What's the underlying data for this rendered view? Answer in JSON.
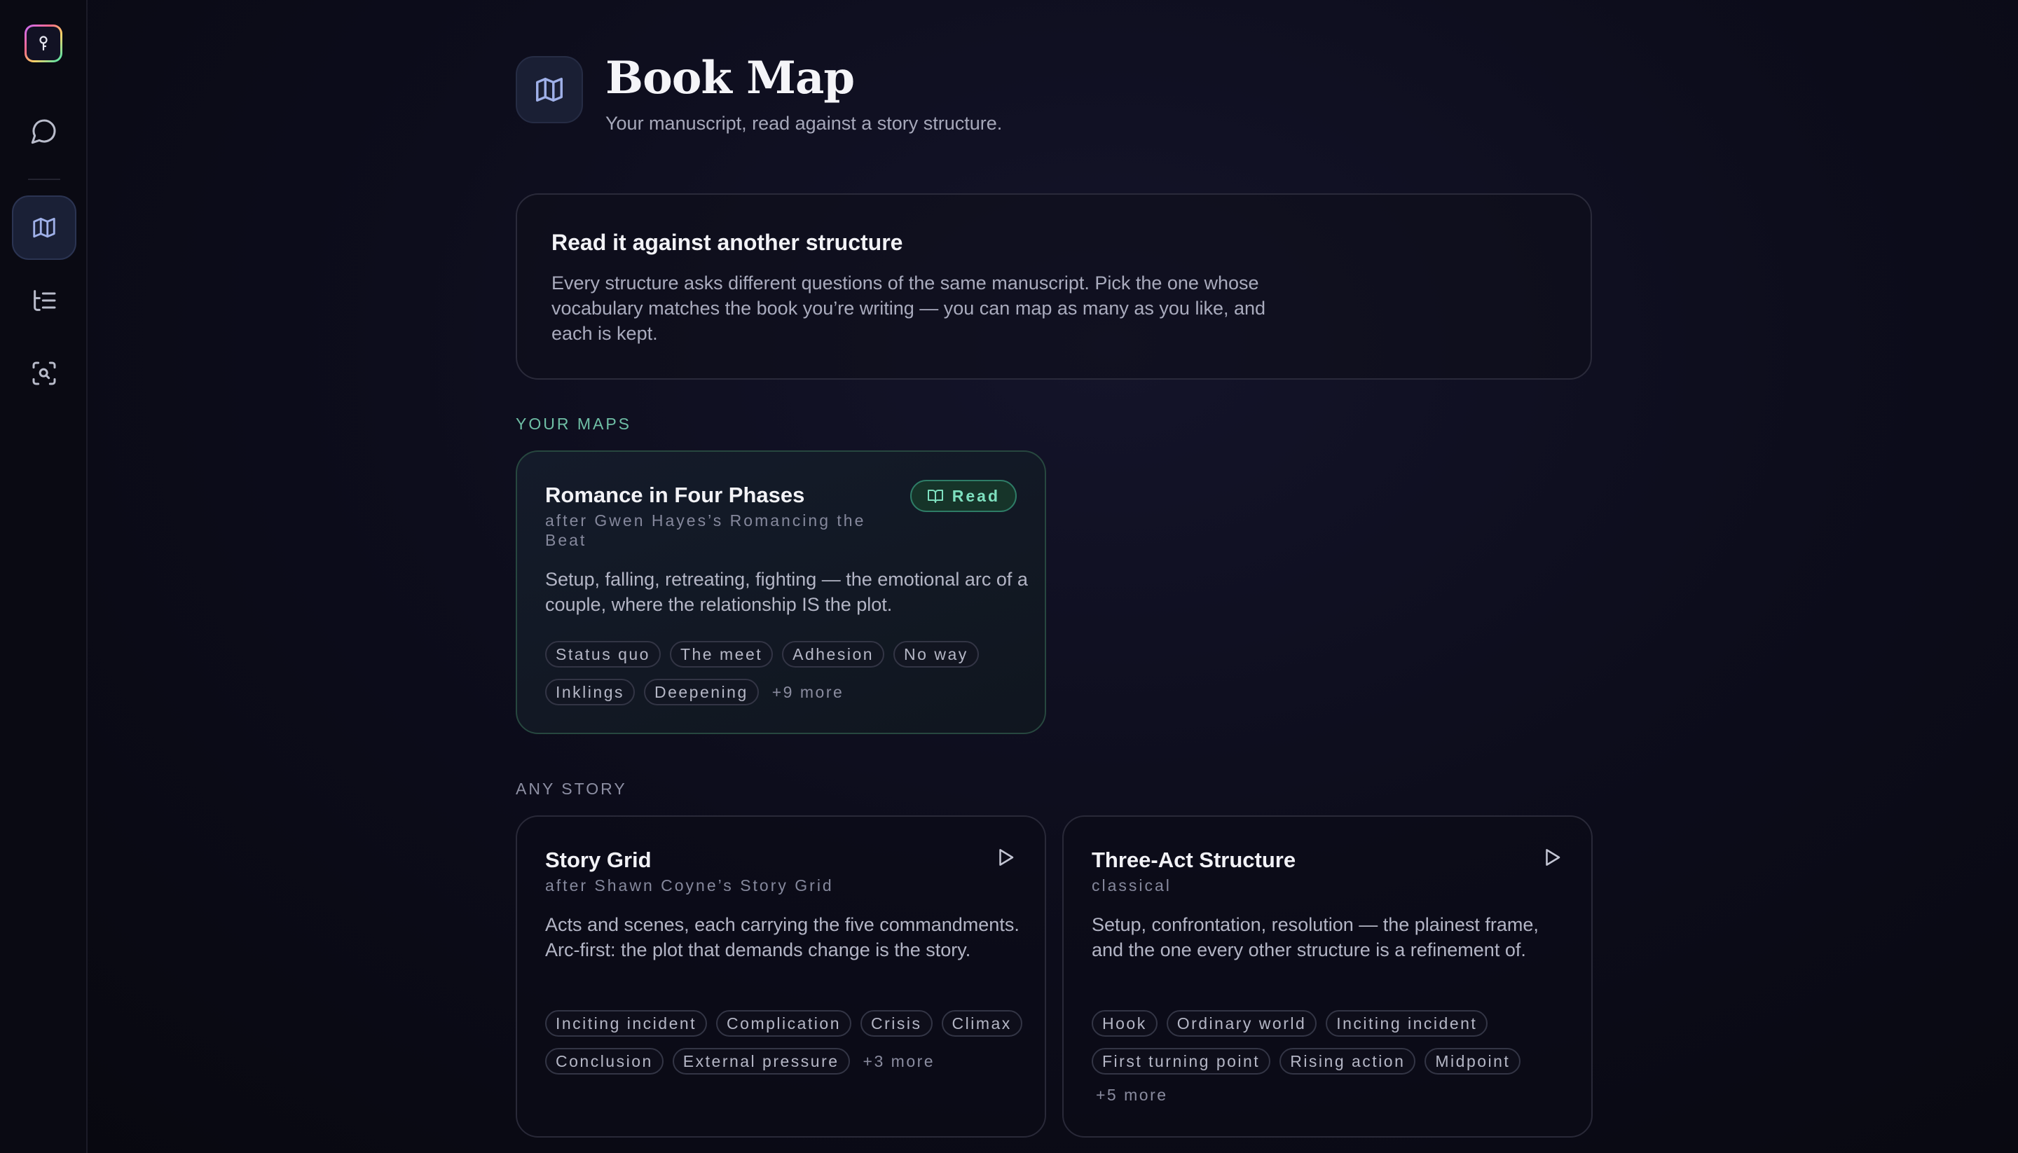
{
  "sidebar": {
    "logo_icon": "keyhole-icon",
    "items": [
      {
        "name": "chat",
        "icon": "chat-bubble-icon",
        "active": false
      },
      {
        "name": "book-map",
        "icon": "map-icon",
        "active": true
      },
      {
        "name": "outline",
        "icon": "outline-list-icon",
        "active": false
      },
      {
        "name": "scan",
        "icon": "scan-search-icon",
        "active": false
      }
    ]
  },
  "header": {
    "icon": "map-icon",
    "title": "Book Map",
    "subtitle": "Your manuscript, read against a story structure."
  },
  "intro": {
    "title": "Read it against another structure",
    "body": "Every structure asks different questions of the same manuscript. Pick the one whose vocabulary matches the book you’re writing — you can map as many as you like, and each is kept."
  },
  "your_maps": {
    "label": "YOUR MAPS",
    "cards": [
      {
        "title": "Romance in Four Phases",
        "byline": "after Gwen Hayes’s Romancing the Beat",
        "description": "Setup, falling, retreating, fighting — the emotional arc of a couple, where the relationship IS the plot.",
        "action_label": "Read",
        "chips": [
          "Status quo",
          "The meet",
          "Adhesion",
          "No way",
          "Inklings",
          "Deepening"
        ],
        "more": "+9 more"
      }
    ]
  },
  "any_story": {
    "label": "ANY STORY",
    "cards": [
      {
        "title": "Story Grid",
        "byline": "after Shawn Coyne’s Story Grid",
        "description": "Acts and scenes, each carrying the five commandments. Arc-first: the plot that demands change is the story.",
        "chips": [
          "Inciting incident",
          "Complication",
          "Crisis",
          "Climax",
          "Conclusion",
          "External pressure"
        ],
        "more": "+3 more"
      },
      {
        "title": "Three-Act Structure",
        "byline": "classical",
        "description": "Setup, confrontation, resolution — the plainest frame, and the one every other structure is a refinement of.",
        "chips": [
          "Hook",
          "Ordinary world",
          "Inciting incident",
          "First turning point",
          "Rising action",
          "Midpoint"
        ],
        "more": "+5 more"
      }
    ]
  },
  "colors": {
    "accent_green": "#7ee0bf",
    "section_maps": "#6fbfa6",
    "background": "#0d0d1c"
  }
}
